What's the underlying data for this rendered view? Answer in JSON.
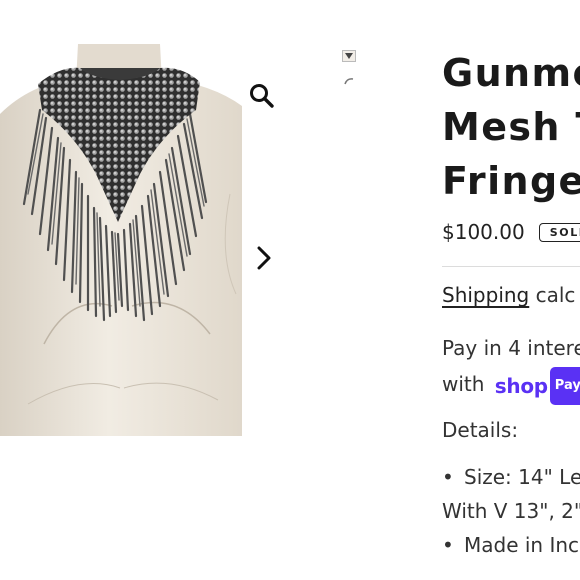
{
  "product": {
    "title_lines": [
      "Gunmetal",
      "Mesh T",
      "Fringe"
    ],
    "price": "$100.00",
    "sold_badge": "SOLD",
    "shipping_link": "Shipping",
    "shipping_text": " calc",
    "installments_line1": "Pay in 4 intere",
    "installments_with": "with ",
    "shoppay_shop": "shop",
    "shoppay_pay": "Pay",
    "details_label": "Details:",
    "details": [
      {
        "bullet": "•",
        "line1": "Size: 14\" Le",
        "line2": "With V 13\", 2\""
      },
      {
        "bullet": "•",
        "line1": "Made in Inc"
      }
    ]
  },
  "icons": {
    "zoom": "magnifier-icon",
    "next": "chevron-right-icon"
  },
  "colors": {
    "shoppay_purple": "#5a31f4",
    "text_dark": "#1c1c1c",
    "divider": "#dcdcdc",
    "mannequin": "#ece6dc",
    "necklace": "#4e4e4e"
  }
}
